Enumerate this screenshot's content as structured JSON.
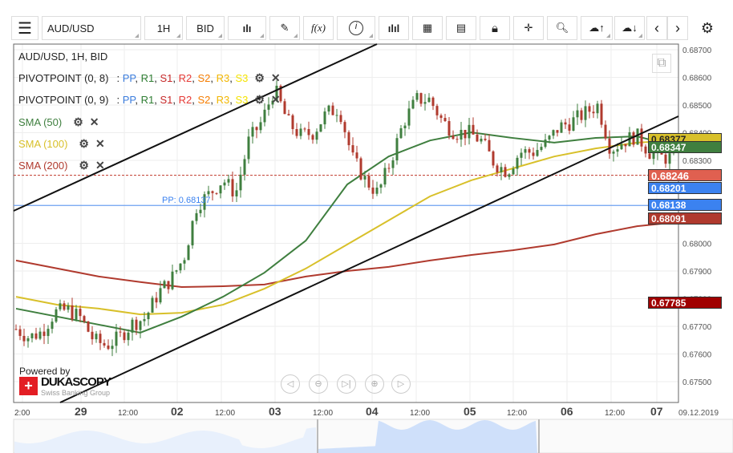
{
  "toolbar": {
    "symbol": "AUD/USD",
    "period": "1H",
    "side": "BID",
    "icons": [
      "menu-icon",
      "candles-icon",
      "pencil-icon",
      "fx-icon",
      "info-icon",
      "bars-icon",
      "calendar-icon",
      "report-icon",
      "lock-icon",
      "crosshair-icon",
      "zoom-chart-icon",
      "upload-icon",
      "download-icon",
      "chevron-left-icon",
      "chevron-right-icon",
      "gear-icon"
    ],
    "fx_label": "f(x)"
  },
  "legend": {
    "title": "AUD/USD, 1H, BID",
    "pivots": [
      {
        "label": "PIVOTPOINT (0, 8)"
      },
      {
        "label": "PIVOTPOINT (0, 9)"
      }
    ],
    "pivot_parts": [
      {
        "t": "PP",
        "c": "#3b7ddd"
      },
      {
        "t": "R1",
        "c": "#2e7d32"
      },
      {
        "t": "S1",
        "c": "#c62828"
      },
      {
        "t": "R2",
        "c": "#e53935"
      },
      {
        "t": "S2",
        "c": "#f57c00"
      },
      {
        "t": "R3",
        "c": "#f2b600"
      },
      {
        "t": "S3",
        "c": "#f5e400"
      }
    ],
    "smas": [
      {
        "label": "SMA (50)",
        "color": "#3f7f3f"
      },
      {
        "label": "SMA (100)",
        "color": "#d8c02a"
      },
      {
        "label": "SMA (200)",
        "color": "#b03a2e"
      }
    ]
  },
  "price_labels": [
    {
      "text": "0.68377",
      "bg": "#d8c02a",
      "fg": "#222",
      "price": 0.68377
    },
    {
      "text": "0.68347",
      "bg": "#3f7f3f",
      "fg": "#fff",
      "price": 0.68347
    },
    {
      "text": "0.68246",
      "bg": "#e06050",
      "fg": "#fff",
      "price": 0.68246
    },
    {
      "text": "0.68201",
      "bg": "#3b82f0",
      "fg": "#fff",
      "price": 0.68201
    },
    {
      "text": "0.68138",
      "bg": "#3b82f0",
      "fg": "#fff",
      "price": 0.68138
    },
    {
      "text": "0.68091",
      "bg": "#b03a2e",
      "fg": "#fff",
      "price": 0.68091
    },
    {
      "text": "0.67785",
      "bg": "#a00000",
      "fg": "#fff",
      "price": 0.67785
    }
  ],
  "pp_label": "PP: 0.68137",
  "powered_by": "Powered by",
  "brand": "DUKASCOPY",
  "brand_sub": "Swiss Banking Group",
  "date_label": "09.12.2019",
  "chart_data": {
    "type": "candlestick",
    "ylim": [
      0.6745,
      0.6875
    ],
    "yticks": [
      "0.68700",
      "0.68600",
      "0.68500",
      "0.68400",
      "0.68300",
      "0.68000",
      "0.67900",
      "0.67800",
      "0.67700",
      "0.67600",
      "0.67500"
    ],
    "xticks": [
      {
        "t": "2:00",
        "day": false
      },
      {
        "t": "29",
        "day": true
      },
      {
        "t": "12:00",
        "day": false
      },
      {
        "t": "02",
        "day": true
      },
      {
        "t": "12:00",
        "day": false
      },
      {
        "t": "03",
        "day": true
      },
      {
        "t": "12:00",
        "day": false
      },
      {
        "t": "04",
        "day": true
      },
      {
        "t": "12:00",
        "day": false
      },
      {
        "t": "05",
        "day": true
      },
      {
        "t": "12:00",
        "day": false
      },
      {
        "t": "06",
        "day": true
      },
      {
        "t": "12:00",
        "day": false
      },
      {
        "t": "07",
        "day": true
      }
    ],
    "close_keyframes": [
      0.6769,
      0.6766,
      0.6768,
      0.6775,
      0.6776,
      0.6773,
      0.6765,
      0.6763,
      0.6766,
      0.6771,
      0.6773,
      0.6782,
      0.6787,
      0.6795,
      0.6814,
      0.6818,
      0.6823,
      0.6818,
      0.6837,
      0.6844,
      0.6856,
      0.6844,
      0.6839,
      0.684,
      0.6847,
      0.6849,
      0.6831,
      0.6823,
      0.6818,
      0.683,
      0.6844,
      0.6852,
      0.6852,
      0.6844,
      0.684,
      0.684,
      0.6837,
      0.6829,
      0.6826,
      0.6833,
      0.6833,
      0.6836,
      0.6842,
      0.6844,
      0.6847,
      0.685,
      0.6834,
      0.6837,
      0.6839,
      0.6833,
      0.6831,
      0.6831
    ],
    "sma50": [
      0.67764,
      0.67735,
      0.67706,
      0.67677,
      0.67735,
      0.67807,
      0.67894,
      0.6801,
      0.68213,
      0.68314,
      0.68372,
      0.68401,
      0.68381,
      0.68364,
      0.68381,
      0.68387,
      0.68348
    ],
    "sma100": [
      0.67807,
      0.67778,
      0.67764,
      0.67743,
      0.67749,
      0.67778,
      0.67836,
      0.67909,
      0.67996,
      0.68083,
      0.6817,
      0.68228,
      0.68271,
      0.68314,
      0.68343,
      0.68364,
      0.68372
    ],
    "sma200": [
      0.67938,
      0.67909,
      0.6788,
      0.6786,
      0.67842,
      0.67845,
      0.67851,
      0.6788,
      0.679,
      0.67915,
      0.67938,
      0.67958,
      0.67975,
      0.67996,
      0.68033,
      0.68062,
      0.68077
    ],
    "pivot_pp": 0.68137,
    "last_price": 0.68246
  }
}
